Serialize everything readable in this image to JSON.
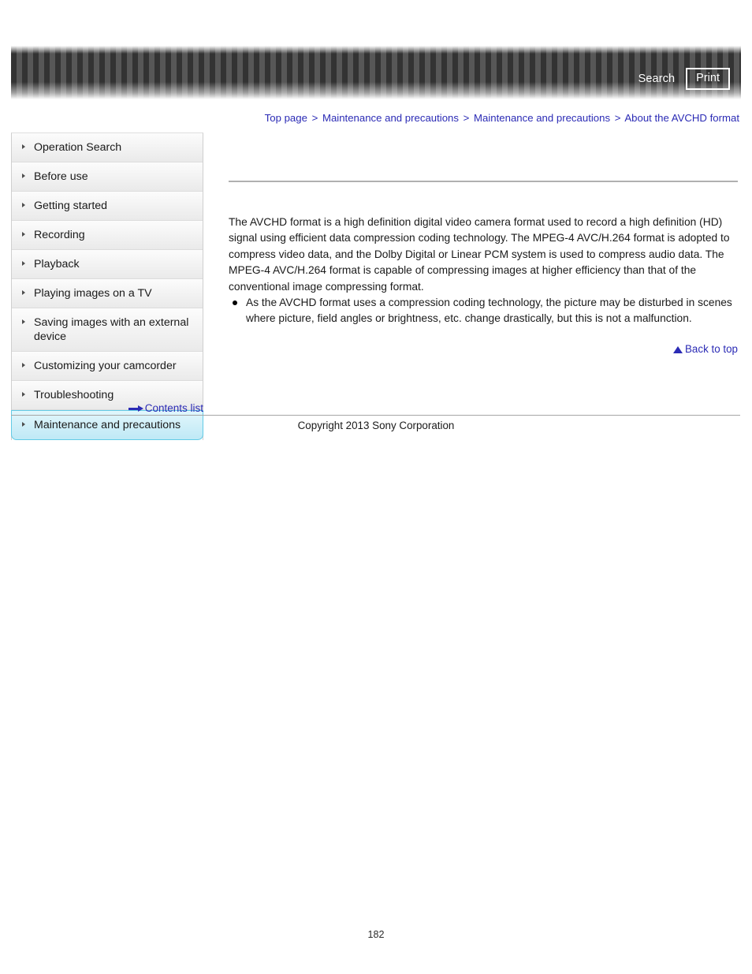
{
  "header": {
    "search_label": "Search",
    "print_label": "Print"
  },
  "breadcrumb": {
    "separator": ">",
    "items": [
      {
        "label": "Top page"
      },
      {
        "label": "Maintenance and precautions"
      },
      {
        "label": "Maintenance and precautions"
      },
      {
        "label": "About the AVCHD format"
      }
    ]
  },
  "sidebar": {
    "items": [
      {
        "label": "Operation Search",
        "active": false
      },
      {
        "label": "Before use",
        "active": false
      },
      {
        "label": "Getting started",
        "active": false
      },
      {
        "label": "Recording",
        "active": false
      },
      {
        "label": "Playback",
        "active": false
      },
      {
        "label": "Playing images on a TV",
        "active": false
      },
      {
        "label": "Saving images with an external device",
        "active": false
      },
      {
        "label": "Customizing your camcorder",
        "active": false
      },
      {
        "label": "Troubleshooting",
        "active": false
      },
      {
        "label": "Maintenance and precautions",
        "active": true
      }
    ],
    "contents_list_label": "Contents list"
  },
  "main": {
    "title": "",
    "paragraph": "The AVCHD format is a high definition digital video camera format used to record a high definition (HD) signal using efficient data compression coding technology. The MPEG-4 AVC/H.264 format is adopted to compress video data, and the Dolby Digital or Linear PCM system is used to compress audio data. The MPEG-4 AVC/H.264 format is capable of compressing images at higher efficiency than that of the conventional image compressing format.",
    "bullets": [
      "As the AVCHD format uses a compression coding technology, the picture may be disturbed in scenes where picture, field angles or brightness, etc. change drastically, but this is not a malfunction."
    ],
    "back_to_top_label": "Back to top"
  },
  "footer": {
    "copyright": "Copyright 2013 Sony Corporation",
    "page_number": "182"
  },
  "colors": {
    "link_blue": "#2b2bb5",
    "active_nav_cyan": "#63cbe6",
    "banner_dark": "#333333",
    "banner_light": "#575757"
  }
}
